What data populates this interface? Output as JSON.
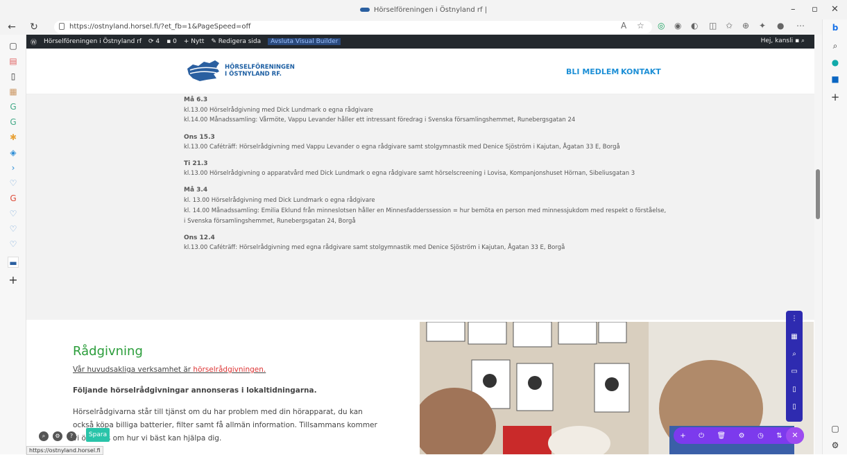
{
  "browser": {
    "tab_title": "Hörselföreningen i Östnyland rf |",
    "url": "https://ostnyland.horsel.fi/?et_fb=1&PageSpeed=off",
    "status_url": "https://ostnyland.horsel.fi"
  },
  "wp_admin_bar": {
    "site_name": "Hörselföreningen i Östnyland rf",
    "updates": "4",
    "comments": "0",
    "new": "Nytt",
    "edit": "Redigera sida",
    "exit_builder": "Avsluta Visual Builder",
    "greeting": "Hej, kansli"
  },
  "header": {
    "logo_line1": "HÖRSELFÖRENINGEN",
    "logo_line2": "I ÖSTNYLAND RF.",
    "nav": [
      "BLI MEDLEM",
      "KONTAKT"
    ]
  },
  "events": [
    {
      "date": "Må 6.3",
      "lines": [
        "kl.13.00 Hörselrådgivning med Dick Lundmark o egna rådgivare",
        "kl.14.00 Månadssamling: Vårmöte, Vappu Levander håller ett intressant föredrag i Svenska församlingshemmet, Runebergsgatan 24"
      ]
    },
    {
      "date": "Ons 15.3",
      "lines": [
        "kl.13.00 Caféträff: Hörselrådgivning med Vappu Levander o egna rådgivare samt stolgymnastik med Denice Sjöström i Kajutan, Ågatan 33 E, Borgå"
      ]
    },
    {
      "date": "Ti 21.3",
      "lines": [
        "kl.13.00 Hörselrådgivning o apparatvård med Dick Lundmark o egna rådgivare samt hörselscreening i Lovisa, Kompanjonshuset Hörnan, Sibeliusgatan 3"
      ]
    },
    {
      "date": "Må 3.4",
      "lines": [
        "kl. 13.00 Hörselrådgivning med Dick Lundmark o egna rådgivare",
        "kl. 14.00 Månadssamling: Emilia Eklund från minneslotsen håller en Minnesfadderssession = hur bemöta en person med minnessjukdom med respekt o förståelse,",
        "i Svenska församlingshemmet, Runebergsgatan 24, Borgå"
      ]
    },
    {
      "date": "Ons 12.4",
      "lines": [
        "kl.13.00 Caféträff: Hörselrådgivning med egna rådgivare samt stolgymnastik med Denice Sjöström i Kajutan, Ågatan 33 E, Borgå"
      ]
    }
  ],
  "radgivning": {
    "title": "Rådgivning",
    "intro_prefix": "Vår huvudsakliga verksamhet är ",
    "intro_link": "hörselrådgivningen.",
    "bold_line": "Följande hörselrådgivningar annonseras i lokaltidningarna.",
    "para_line1": "Hörselrådgivarna står till tjänst om du har problem med din hörapparat, du kan",
    "para_line2": "också köpa billiga batterier, filter samt få allmän information. Tillsammans kommer",
    "para_line3": "vi överens om hur vi bäst kan hjälpa dig."
  },
  "builder": {
    "save_label": "Spara"
  },
  "colors": {
    "accent_green": "#2a9d3a",
    "nav_blue": "#1d8fd6",
    "builder_purple": "#7c3aed"
  }
}
